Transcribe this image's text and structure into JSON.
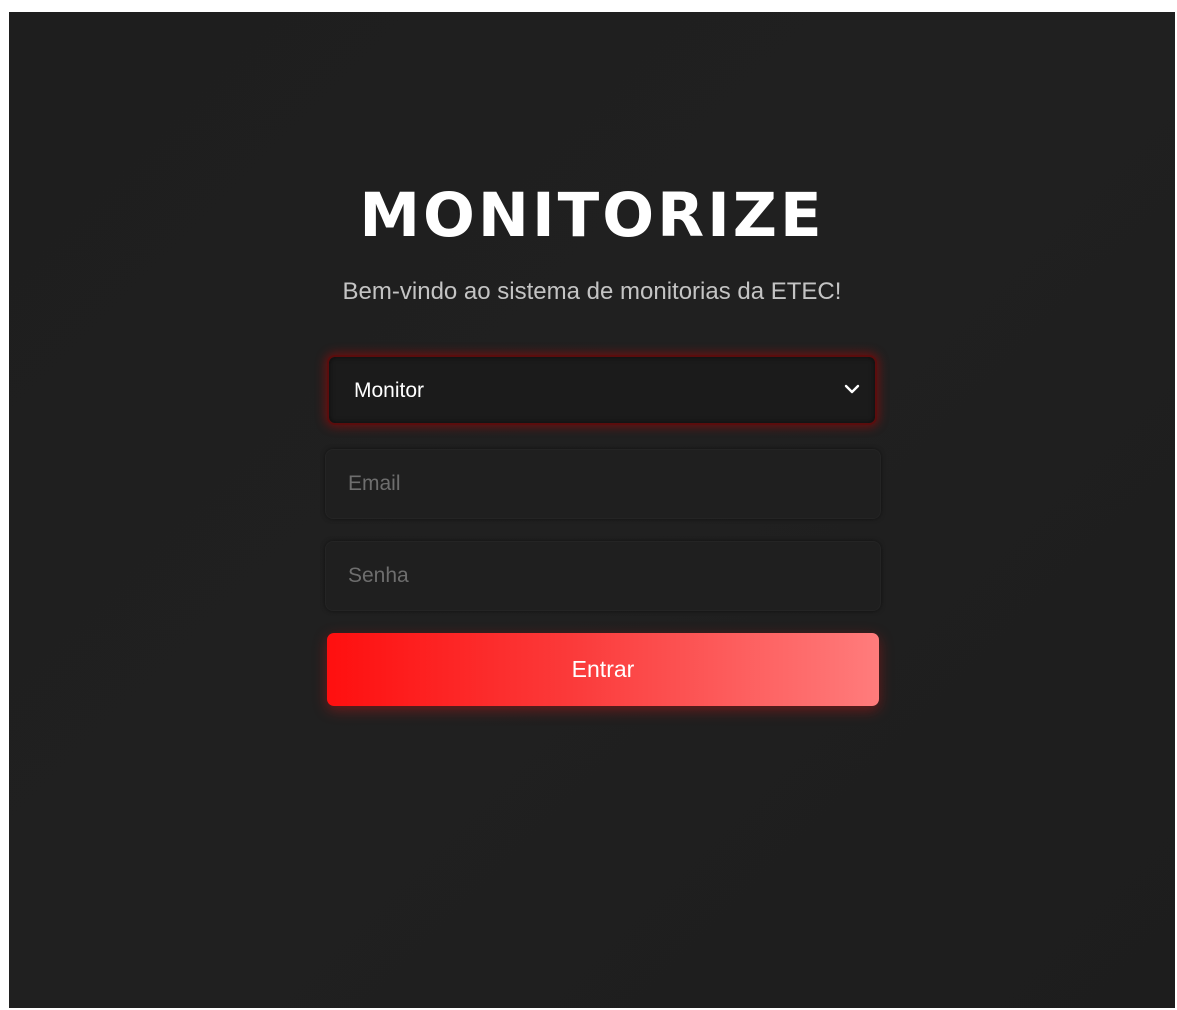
{
  "app": {
    "brand": "MONITORIZE",
    "subtitle": "Bem-vindo ao sistema de monitorias da ETEC!"
  },
  "form": {
    "role_select": {
      "value": "Monitor",
      "icon": "chevron-down-icon"
    },
    "email": {
      "value": "",
      "placeholder": "Email"
    },
    "password": {
      "value": "",
      "placeholder": "Senha"
    },
    "submit_label": "Entrar"
  },
  "colors": {
    "background": "#1f1f1f",
    "accent": "#ff1010",
    "accent_light": "#ff7c7c",
    "text_primary": "#ffffff",
    "text_secondary": "#c4c4c4",
    "placeholder": "#6e6e6e"
  }
}
